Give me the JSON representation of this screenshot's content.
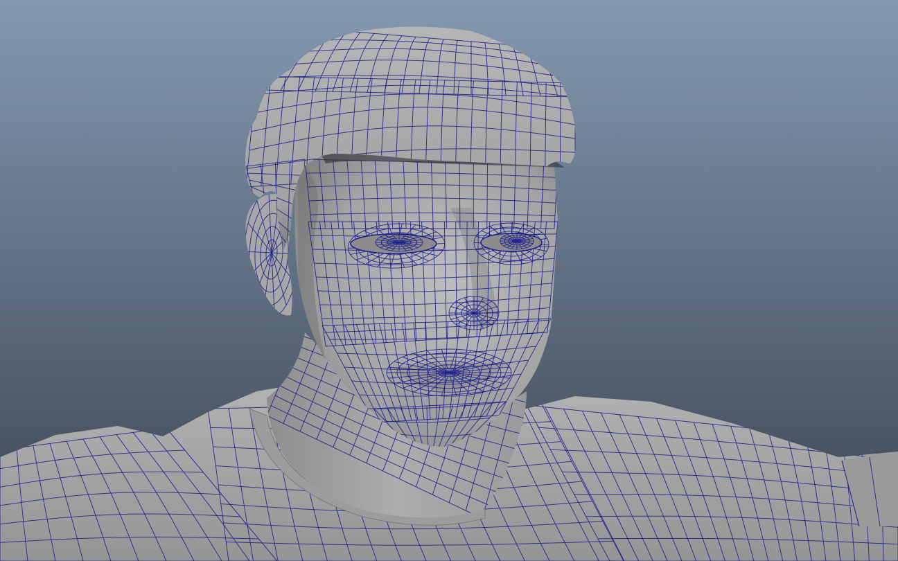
{
  "viewport": {
    "background_top": "#8499b1",
    "background_bottom": "#3a4450",
    "mesh_fill": "#a9a9a9",
    "mesh_shade": "#6f6f6f",
    "mesh_highlight": "#c4c4c4",
    "wire_color": "#1c1f8c",
    "wire_opacity": 0.85
  }
}
